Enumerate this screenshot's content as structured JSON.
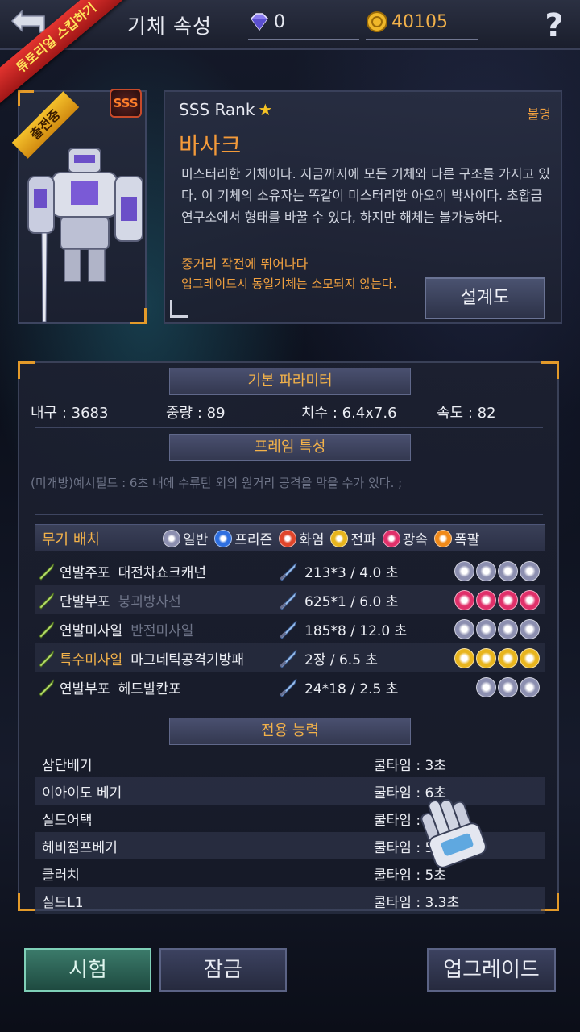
{
  "header": {
    "title": "기체 속성",
    "gems": "0",
    "coins": "40105",
    "tutorial_ribbon": "튜토리얼 스킵하기"
  },
  "mech": {
    "deploy_badge": "출전중",
    "grade_badge": "SSS",
    "rank": "SSS  Rank",
    "origin": "불명",
    "name": "바사크",
    "description": "미스터리한 기체이다. 지금까지에 모든 기체와 다른 구조를 가지고 있다. 이 기체의 소유자는 똑같이 미스터리한 아오이 박사이다. 초합금 연구소에서 형태를 바꿀 수 있다, 하지만 해체는 불가능하다.",
    "feature_line1": "중거리 작전에 뛰어나다",
    "feature_line2": "업그레이드시 동일기체는 소모되지 않는다.",
    "blueprint_label": "설계도"
  },
  "basic_params": {
    "header": "기본 파라미터",
    "durability": "내구 : 3683",
    "weight": "중량 : 89",
    "size": "치수 : 6.4x7.6",
    "speed": "속도 : 82"
  },
  "frame": {
    "header": "프레임 특성",
    "trait": "(미개방)예시필드 : 6초 내에 수류탄 외의 원거리 공격을 막을 수가 있다. ;"
  },
  "weapons": {
    "header": "무기 배치",
    "elements": [
      {
        "label": "일반",
        "color": "#8c8fb0"
      },
      {
        "label": "프리즌",
        "color": "#2e6fe0"
      },
      {
        "label": "화염",
        "color": "#e0452a"
      },
      {
        "label": "전파",
        "color": "#e8b51e"
      },
      {
        "label": "광속",
        "color": "#e0306a"
      },
      {
        "label": "폭팔",
        "color": "#f08a1a"
      }
    ],
    "rows": [
      {
        "type": "연발주포",
        "name": "대전차쇼크캐넌",
        "stat": "213*3 / 4.0 초",
        "icon": "double-cannon-icon",
        "elem_color": "#8c8fb0",
        "elem_count": 4,
        "locked": false,
        "special": false
      },
      {
        "type": "단발부포",
        "name": "붕괴방사선",
        "stat": "625*1 / 6.0 초",
        "icon": "beam-gun-icon",
        "elem_color": "#e0306a",
        "elem_count": 4,
        "locked": true,
        "special": false
      },
      {
        "type": "연발미사일",
        "name": "반전미사일",
        "stat": "185*8 / 12.0 초",
        "icon": "missile-icon",
        "elem_color": "#8c8fb0",
        "elem_count": 4,
        "locked": true,
        "special": false
      },
      {
        "type": "특수미사일",
        "name": "마그네틱공격기방패",
        "stat": "2장 / 6.5 초",
        "icon": "special-missile-icon",
        "elem_color": "#e8b51e",
        "elem_count": 4,
        "locked": false,
        "special": true
      },
      {
        "type": "연발부포",
        "name": "헤드발칸포",
        "stat": "24*18 / 2.5 초",
        "icon": "vulcan-icon",
        "elem_color": "#8c8fb0",
        "elem_count": 3,
        "locked": false,
        "special": false
      }
    ]
  },
  "skills": {
    "header": "전용 능력",
    "rows": [
      {
        "name": "삼단베기",
        "cooldown": "쿨타임 : 3초"
      },
      {
        "name": "이아이도 베기",
        "cooldown": "쿨타임 : 6초"
      },
      {
        "name": "실드어택",
        "cooldown": "쿨타임 : 5초"
      },
      {
        "name": "헤비점프베기",
        "cooldown": "쿨타임 : 5초"
      },
      {
        "name": "클러치",
        "cooldown": "쿨타임 : 5초"
      },
      {
        "name": "실드L1",
        "cooldown": "쿨타임 : 3.3초"
      }
    ]
  },
  "footer": {
    "test_label": "시험",
    "lock_label": "잠금",
    "upgrade_label": "업그레이드"
  }
}
